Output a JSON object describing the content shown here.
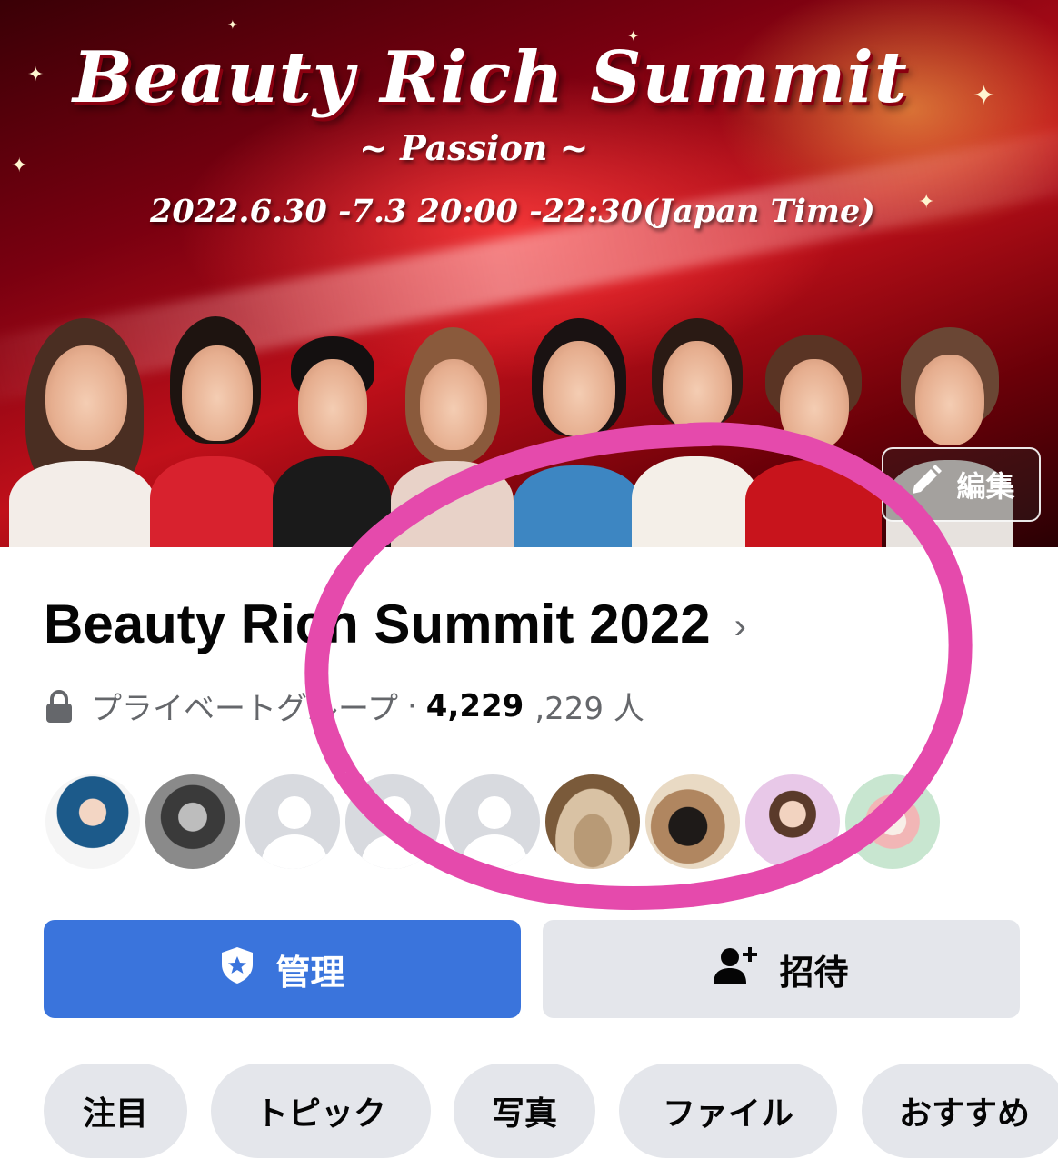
{
  "cover": {
    "title": "Beauty Rich Summit",
    "subtitle": "~ Passion ~",
    "date": "2022.6.30 -7.3 20:00 -22:30(Japan Time)",
    "edit_label": "編集",
    "edit_icon": "pencil-icon"
  },
  "group": {
    "name": "Beauty Rich Summit 2022",
    "privacy": "プライベートグループ",
    "separator": "·",
    "member_count": "4,229",
    "member_suffix": ",229 人"
  },
  "actions": {
    "manage_label": "管理",
    "manage_icon": "shield-star-icon",
    "invite_label": "招待",
    "invite_icon": "add-person-icon"
  },
  "tabs": [
    "注目",
    "トピック",
    "写真",
    "ファイル",
    "おすすめ"
  ],
  "colors": {
    "accent_blue": "#3a74dc",
    "secondary_gray": "#e4e6eb",
    "annotation_pink": "#e54aac",
    "text_secondary": "#65676b"
  }
}
